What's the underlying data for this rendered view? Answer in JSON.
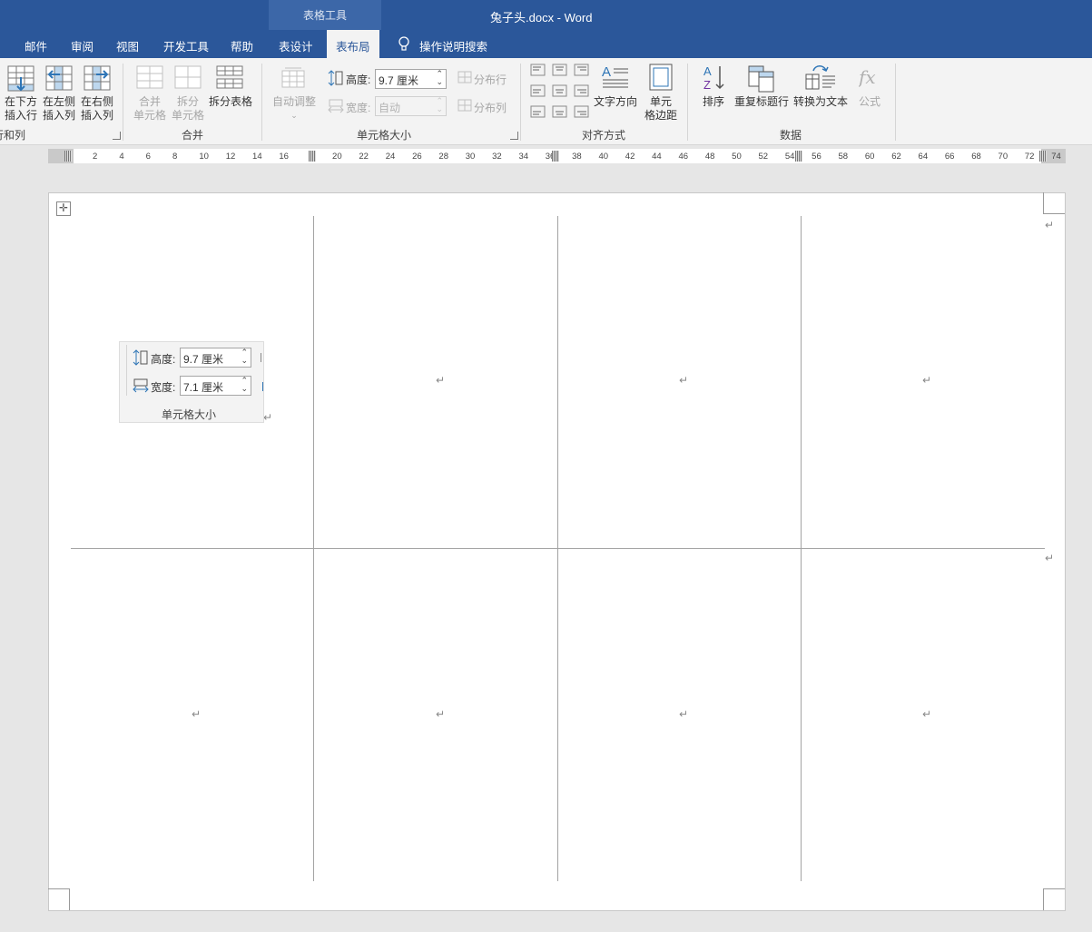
{
  "titlebar": {
    "tools_label": "表格工具",
    "doc_title": "兔子头.docx  -  Word"
  },
  "tabs": [
    {
      "label": "邮件"
    },
    {
      "label": "审阅"
    },
    {
      "label": "视图"
    },
    {
      "label": "开发工具"
    },
    {
      "label": "帮助"
    },
    {
      "label": "表设计"
    },
    {
      "label": "表布局",
      "active": true
    }
  ],
  "tell_me": "操作说明搜索",
  "ribbon": {
    "rows_cols": {
      "insert_below": [
        "在下方",
        "插入行"
      ],
      "insert_left": [
        "在左侧",
        "插入列"
      ],
      "insert_right": [
        "在右侧",
        "插入列"
      ],
      "label": "行和列"
    },
    "merge": {
      "merge_cells": [
        "合并",
        "单元格"
      ],
      "split_cells": [
        "拆分",
        "单元格"
      ],
      "split_table": "拆分表格",
      "label": "合并"
    },
    "cell_size": {
      "autofit": "自动调整",
      "height_label": "高度:",
      "height_value": "9.7 厘米",
      "width_label": "宽度:",
      "width_value": "自动",
      "distribute_rows": "分布行",
      "distribute_cols": "分布列",
      "label": "单元格大小"
    },
    "alignment": {
      "text_direction": "文字方向",
      "cell_margins": [
        "单元",
        "格边距"
      ],
      "label": "对齐方式"
    },
    "data": {
      "sort": "排序",
      "repeat_header": "重复标题行",
      "convert_text": "转换为文本",
      "formula": "公式",
      "label": "数据"
    }
  },
  "ruler": {
    "numbers": [
      "2",
      "4",
      "6",
      "8",
      "10",
      "12",
      "14",
      "16",
      "20",
      "22",
      "24",
      "26",
      "28",
      "30",
      "32",
      "34",
      "36",
      "38",
      "40",
      "42",
      "44",
      "46",
      "48",
      "50",
      "52",
      "54",
      "56",
      "58",
      "60",
      "62",
      "64",
      "66",
      "68",
      "70",
      "72",
      "74"
    ]
  },
  "mini_panel": {
    "height_label": "高度:",
    "height_value": "9.7 厘米",
    "width_label": "宽度:",
    "width_value": "7.1 厘米",
    "label": "单元格大小"
  },
  "document": {
    "paragraph_mark": "↵",
    "return_mark": "↵"
  },
  "colors": {
    "title_blue": "#2b579a",
    "ribbon_bg": "#f3f3f3",
    "accent_icon": "#2e75b6"
  }
}
